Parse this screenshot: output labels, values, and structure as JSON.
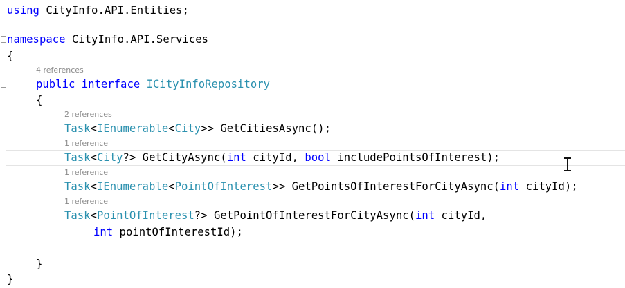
{
  "editor": {
    "line_using": {
      "kw_using": "using",
      "ns": " CityInfo.API.Entities;"
    },
    "line_namespace": {
      "kw_namespace": "namespace",
      "ns": " CityInfo.API.Services"
    },
    "brace_open": "{",
    "brace_close": "}",
    "interface": {
      "codelens": "4 references",
      "kw_public": "public",
      "kw_interface": " interface ",
      "name": "ICityInfoRepository",
      "brace_open": "{",
      "brace_close": "}"
    },
    "methods": [
      {
        "codelens": "2 references",
        "t_task": "Task",
        "p1": "<",
        "t_ienumerable": "IEnumerable",
        "p2": "<",
        "t_city": "City",
        "p3": ">> GetCitiesAsync();"
      },
      {
        "codelens": "1 reference",
        "t_task": "Task",
        "p1": "<",
        "t_city": "City",
        "p2": "?> GetCityAsync(",
        "kw_int": "int",
        "p3": " cityId, ",
        "kw_bool": "bool",
        "p4": " includePointsOfInterest);"
      },
      {
        "codelens": "1 reference",
        "t_task": "Task",
        "p1": "<",
        "t_ienumerable": "IEnumerable",
        "p2": "<",
        "t_poi": "PointOfInterest",
        "p3": ">> GetPointsOfInterestForCityAsync(",
        "kw_int": "int",
        "p4": " cityId);"
      },
      {
        "codelens": "1 reference",
        "t_task": "Task",
        "p1": "<",
        "t_poi": "PointOfInterest",
        "p2": "?> GetPointOfInterestForCityAsync(",
        "kw_int": "int",
        "p3": " cityId,",
        "cont_kw_int": "int",
        "cont_rest": " pointOfInterestId);"
      }
    ],
    "colors": {
      "keyword": "#0000ff",
      "type": "#2b91af",
      "text": "#000000",
      "codelens": "#8a8a8a",
      "background": "#ffffff"
    }
  }
}
